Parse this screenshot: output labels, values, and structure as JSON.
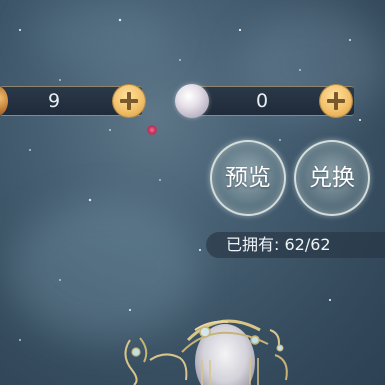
{
  "currencies": [
    {
      "icon": "gold-coin-icon",
      "value": "9"
    },
    {
      "icon": "pearl-icon",
      "value": "0"
    }
  ],
  "buttons": {
    "preview_label": "预览",
    "exchange_label": "兑换"
  },
  "owned": {
    "label": "已拥有:",
    "value": "62/62"
  },
  "colors": {
    "gold_accent": "#f2c16a",
    "bar_background": "#1f2b3a",
    "sky": "#465f72"
  }
}
